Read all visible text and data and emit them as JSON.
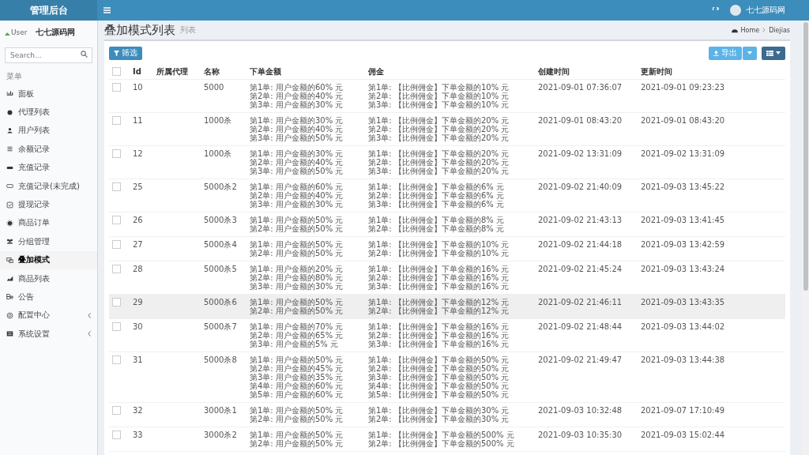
{
  "header": {
    "logo": "管理后台",
    "user_name": "七七源码网"
  },
  "user_panel": {
    "image_alt": "User",
    "name": "七七源码网"
  },
  "search": {
    "placeholder": "Search..."
  },
  "menu_label": "菜单",
  "sidebar": {
    "items": [
      {
        "label": "面板",
        "selected": false,
        "has_submenu": false
      },
      {
        "label": "代理列表",
        "selected": false,
        "has_submenu": false
      },
      {
        "label": "用户列表",
        "selected": false,
        "has_submenu": false
      },
      {
        "label": "余额记录",
        "selected": false,
        "has_submenu": false
      },
      {
        "label": "充值记录",
        "selected": false,
        "has_submenu": false
      },
      {
        "label": "充值记录(未完成)",
        "selected": false,
        "has_submenu": false
      },
      {
        "label": "提现记录",
        "selected": false,
        "has_submenu": false
      },
      {
        "label": "商品订单",
        "selected": false,
        "has_submenu": false
      },
      {
        "label": "分组管理",
        "selected": false,
        "has_submenu": false
      },
      {
        "label": "叠加模式",
        "selected": true,
        "has_submenu": false
      },
      {
        "label": "商品列表",
        "selected": false,
        "has_submenu": false
      },
      {
        "label": "公告",
        "selected": false,
        "has_submenu": false
      },
      {
        "label": "配置中心",
        "selected": false,
        "has_submenu": true
      },
      {
        "label": "系统设置",
        "selected": false,
        "has_submenu": true
      }
    ]
  },
  "page": {
    "title": "叠加模式列表",
    "subtitle": "列表",
    "breadcrumb": [
      "Home",
      "Diejias"
    ]
  },
  "toolbar": {
    "filter_button": "筛选",
    "export_button": "导出"
  },
  "table": {
    "header_checked": false,
    "columns": [
      "Id",
      "所属代理",
      "名称",
      "下单金额",
      "佣金",
      "创建时间",
      "更新时间"
    ],
    "rows": [
      {
        "id": "10",
        "name": "5000",
        "checked": false,
        "hovered": false,
        "orders": [
          "第1单: 用户金额的60% 元",
          "第2单: 用户金额的40% 元",
          "第3单: 用户金额的30% 元"
        ],
        "commission": [
          "第1单: 【比例佣金】下单金额的10% 元",
          "第2单: 【比例佣金】下单金额的10% 元",
          "第3单: 【比例佣金】下单金额的10% 元"
        ],
        "created": "2021-09-01 07:36:07",
        "updated": "2021-09-01 09:23:23"
      },
      {
        "id": "11",
        "name": "1000杀",
        "checked": false,
        "hovered": false,
        "orders": [
          "第1单: 用户金额的30% 元",
          "第2单: 用户金额的40% 元",
          "第3单: 用户金额的50% 元"
        ],
        "commission": [
          "第1单: 【比例佣金】下单金额的20% 元",
          "第2单: 【比例佣金】下单金额的20% 元",
          "第3单: 【比例佣金】下单金额的20% 元"
        ],
        "created": "2021-09-01 08:43:20",
        "updated": "2021-09-01 08:43:20"
      },
      {
        "id": "12",
        "name": "1000杀",
        "checked": false,
        "hovered": false,
        "orders": [
          "第1单: 用户金额的30% 元",
          "第2单: 用户金额的40% 元",
          "第3单: 用户金额的50% 元"
        ],
        "commission": [
          "第1单: 【比例佣金】下单金额的20% 元",
          "第2单: 【比例佣金】下单金额的20% 元",
          "第3单: 【比例佣金】下单金额的20% 元"
        ],
        "created": "2021-09-02 13:31:09",
        "updated": "2021-09-02 13:31:09"
      },
      {
        "id": "25",
        "name": "5000杀2",
        "checked": false,
        "hovered": false,
        "orders": [
          "第1单: 用户金额的60% 元",
          "第2单: 用户金额的40% 元",
          "第3单: 用户金额的30% 元"
        ],
        "commission": [
          "第1单: 【比例佣金】下单金额的6% 元",
          "第2单: 【比例佣金】下单金额的6% 元",
          "第3单: 【比例佣金】下单金额的6% 元"
        ],
        "created": "2021-09-02 21:40:09",
        "updated": "2021-09-03 13:45:22"
      },
      {
        "id": "26",
        "name": "5000杀3",
        "checked": false,
        "hovered": false,
        "orders": [
          "第1单: 用户金额的50% 元",
          "第2单: 用户金额的50% 元"
        ],
        "commission": [
          "第1单: 【比例佣金】下单金额的8% 元",
          "第2单: 【比例佣金】下单金额的8% 元"
        ],
        "created": "2021-09-02 21:43:13",
        "updated": "2021-09-03 13:41:45"
      },
      {
        "id": "27",
        "name": "5000杀4",
        "checked": false,
        "hovered": false,
        "orders": [
          "第1单: 用户金额的50% 元",
          "第2单: 用户金额的50% 元"
        ],
        "commission": [
          "第1单: 【比例佣金】下单金额的10% 元",
          "第2单: 【比例佣金】下单金额的10% 元"
        ],
        "created": "2021-09-02 21:44:18",
        "updated": "2021-09-03 13:42:59"
      },
      {
        "id": "28",
        "name": "5000杀5",
        "checked": false,
        "hovered": false,
        "orders": [
          "第1单: 用户金额的20% 元",
          "第2单: 用户金额的80% 元",
          "第3单: 用户金额的30% 元"
        ],
        "commission": [
          "第1单: 【比例佣金】下单金额的16% 元",
          "第2单: 【比例佣金】下单金额的16% 元",
          "第3单: 【比例佣金】下单金额的16% 元"
        ],
        "created": "2021-09-02 21:45:24",
        "updated": "2021-09-03 13:43:24"
      },
      {
        "id": "29",
        "name": "5000杀6",
        "checked": false,
        "hovered": true,
        "orders": [
          "第1单: 用户金额的50% 元",
          "第2单: 用户金额的50% 元"
        ],
        "commission": [
          "第1单: 【比例佣金】下单金额的12% 元",
          "第2单: 【比例佣金】下单金额的12% 元"
        ],
        "created": "2021-09-02 21:46:11",
        "updated": "2021-09-03 13:43:35"
      },
      {
        "id": "30",
        "name": "5000杀7",
        "checked": false,
        "hovered": false,
        "orders": [
          "第1单: 用户金额的70% 元",
          "第2单: 用户金额的65% 元",
          "第3单: 用户金额的5% 元"
        ],
        "commission": [
          "第1单: 【比例佣金】下单金额的16% 元",
          "第2单: 【比例佣金】下单金额的16% 元",
          "第3单: 【比例佣金】下单金额的16% 元"
        ],
        "created": "2021-09-02 21:48:44",
        "updated": "2021-09-03 13:44:02"
      },
      {
        "id": "31",
        "name": "5000杀8",
        "checked": false,
        "hovered": false,
        "orders": [
          "第1单: 用户金额的50% 元",
          "第2单: 用户金额的45% 元",
          "第3单: 用户金额的35% 元",
          "第4单: 用户金额的60% 元",
          "第5单: 用户金额的60% 元"
        ],
        "commission": [
          "第1单: 【比例佣金】下单金额的50% 元",
          "第2单: 【比例佣金】下单金额的50% 元",
          "第3单: 【比例佣金】下单金额的50% 元",
          "第4单: 【比例佣金】下单金额的50% 元",
          "第5单: 【比例佣金】下单金额的50% 元"
        ],
        "created": "2021-09-02 21:49:47",
        "updated": "2021-09-03 13:44:38"
      },
      {
        "id": "32",
        "name": "3000杀1",
        "checked": false,
        "hovered": false,
        "orders": [
          "第1单: 用户金额的50% 元",
          "第2单: 用户金额的50% 元"
        ],
        "commission": [
          "第1单: 【比例佣金】下单金额的30% 元",
          "第2单: 【比例佣金】下单金额的30% 元"
        ],
        "created": "2021-09-03 10:32:48",
        "updated": "2021-09-07 17:10:49"
      },
      {
        "id": "33",
        "name": "3000杀2",
        "checked": false,
        "hovered": false,
        "orders": [
          "第1单: 用户金额的50% 元",
          "第2单: 用户金额的50% 元"
        ],
        "commission": [
          "第1单: 【比例佣金】下单金额的500% 元",
          "第2单: 【比例佣金】下单金额的500% 元"
        ],
        "created": "2021-09-03 10:35:30",
        "updated": "2021-09-03 15:02:44"
      }
    ]
  }
}
